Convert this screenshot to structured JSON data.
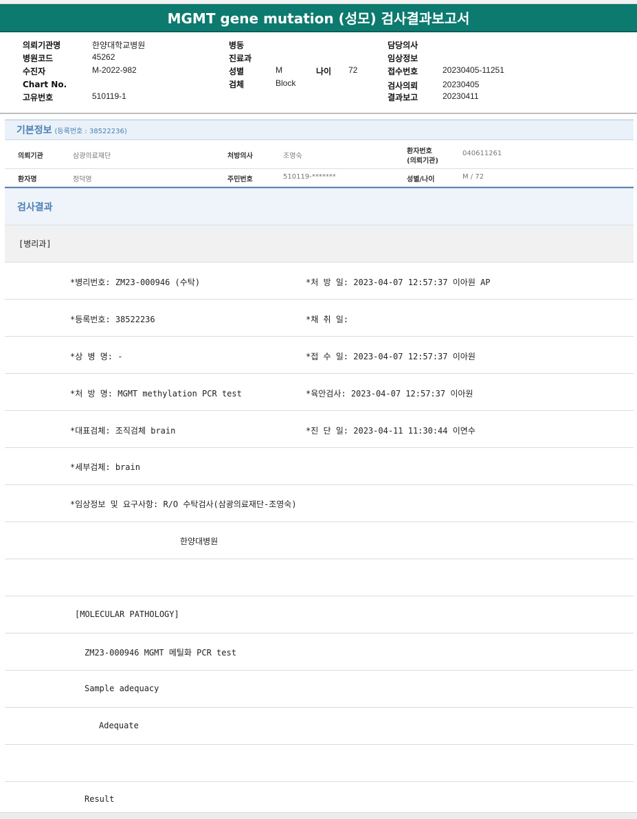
{
  "report": {
    "title": "MGMT gene mutation (성모) 검사결과보고서"
  },
  "header": {
    "col1": [
      {
        "label": "의뢰기관명",
        "value": "한양대학교병원"
      },
      {
        "label": "병원코드",
        "value": "45262"
      },
      {
        "label": "수진자",
        "value": "M-2022-982"
      },
      {
        "label": "Chart No.",
        "value": ""
      },
      {
        "label": "고유번호",
        "value": "510119-1"
      }
    ],
    "col2": {
      "ward_label": "병동",
      "ward_value": "",
      "dept_label": "진료과",
      "dept_value": "",
      "sex_label": "성별",
      "sex_value": "M",
      "age_label": "나이",
      "age_value": "72",
      "specimen_label": "검체",
      "specimen_value": "Block"
    },
    "col3": [
      {
        "label": "담당의사",
        "value": ""
      },
      {
        "label": "임상정보",
        "value": ""
      },
      {
        "label": "접수번호",
        "value": "20230405-11251"
      },
      {
        "label": "검사의뢰",
        "value": "20230405"
      },
      {
        "label": "결과보고",
        "value": "20230411"
      }
    ]
  },
  "basic_info": {
    "title": "기본정보",
    "registration": "(등록번호 : 38522236)",
    "row1": {
      "institution_label": "의뢰기관",
      "institution_value": "삼광의료재단",
      "doctor_label": "처방의사",
      "doctor_value": "조영숙",
      "patient_no_label_1": "환자번호",
      "patient_no_label_2": "(의뢰기관)",
      "patient_no_value": "040611261"
    },
    "row2": {
      "name_label": "환자명",
      "name_value": "정덕영",
      "rrn_label": "주민번호",
      "rrn_value": "510119-*******",
      "sexage_label": "성별/나이",
      "sexage_value": "M / 72"
    }
  },
  "results": {
    "title": "검사결과",
    "department": "[병리과]",
    "lines": {
      "l1_left": "*병리번호: ZM23-000946 (수탁)",
      "l1_right": "*처 방 일: 2023-04-07 12:57:37  이아원 AP",
      "l2_left": "*등록번호: 38522236",
      "l2_right": "*채 취 일:",
      "l3_left": "*상 병 명: -",
      "l3_right": "*접 수 일: 2023-04-07 12:57:37  이아원",
      "l4_left": "*처 방 명: MGMT methylation  PCR test",
      "l4_right": "*육안검사: 2023-04-07 12:57:37  이아원",
      "l5_left": "*대표검체: 조직검체 brain",
      "l5_right": "*진 단 일: 2023-04-11 11:30:44  이연수",
      "l6_left": "*세부검체: brain",
      "l7_left": "*임상정보 및 요구사항: R/O 수탁검사(삼광의료재단-조영숙)",
      "l8_center": "한양대병원",
      "l10": "[MOLECULAR PATHOLOGY]",
      "l11": "ZM23-000946     MGMT 메틸화  PCR test",
      "l12": "Sample adequacy",
      "l13": "Adequate",
      "l15": "Result"
    }
  }
}
